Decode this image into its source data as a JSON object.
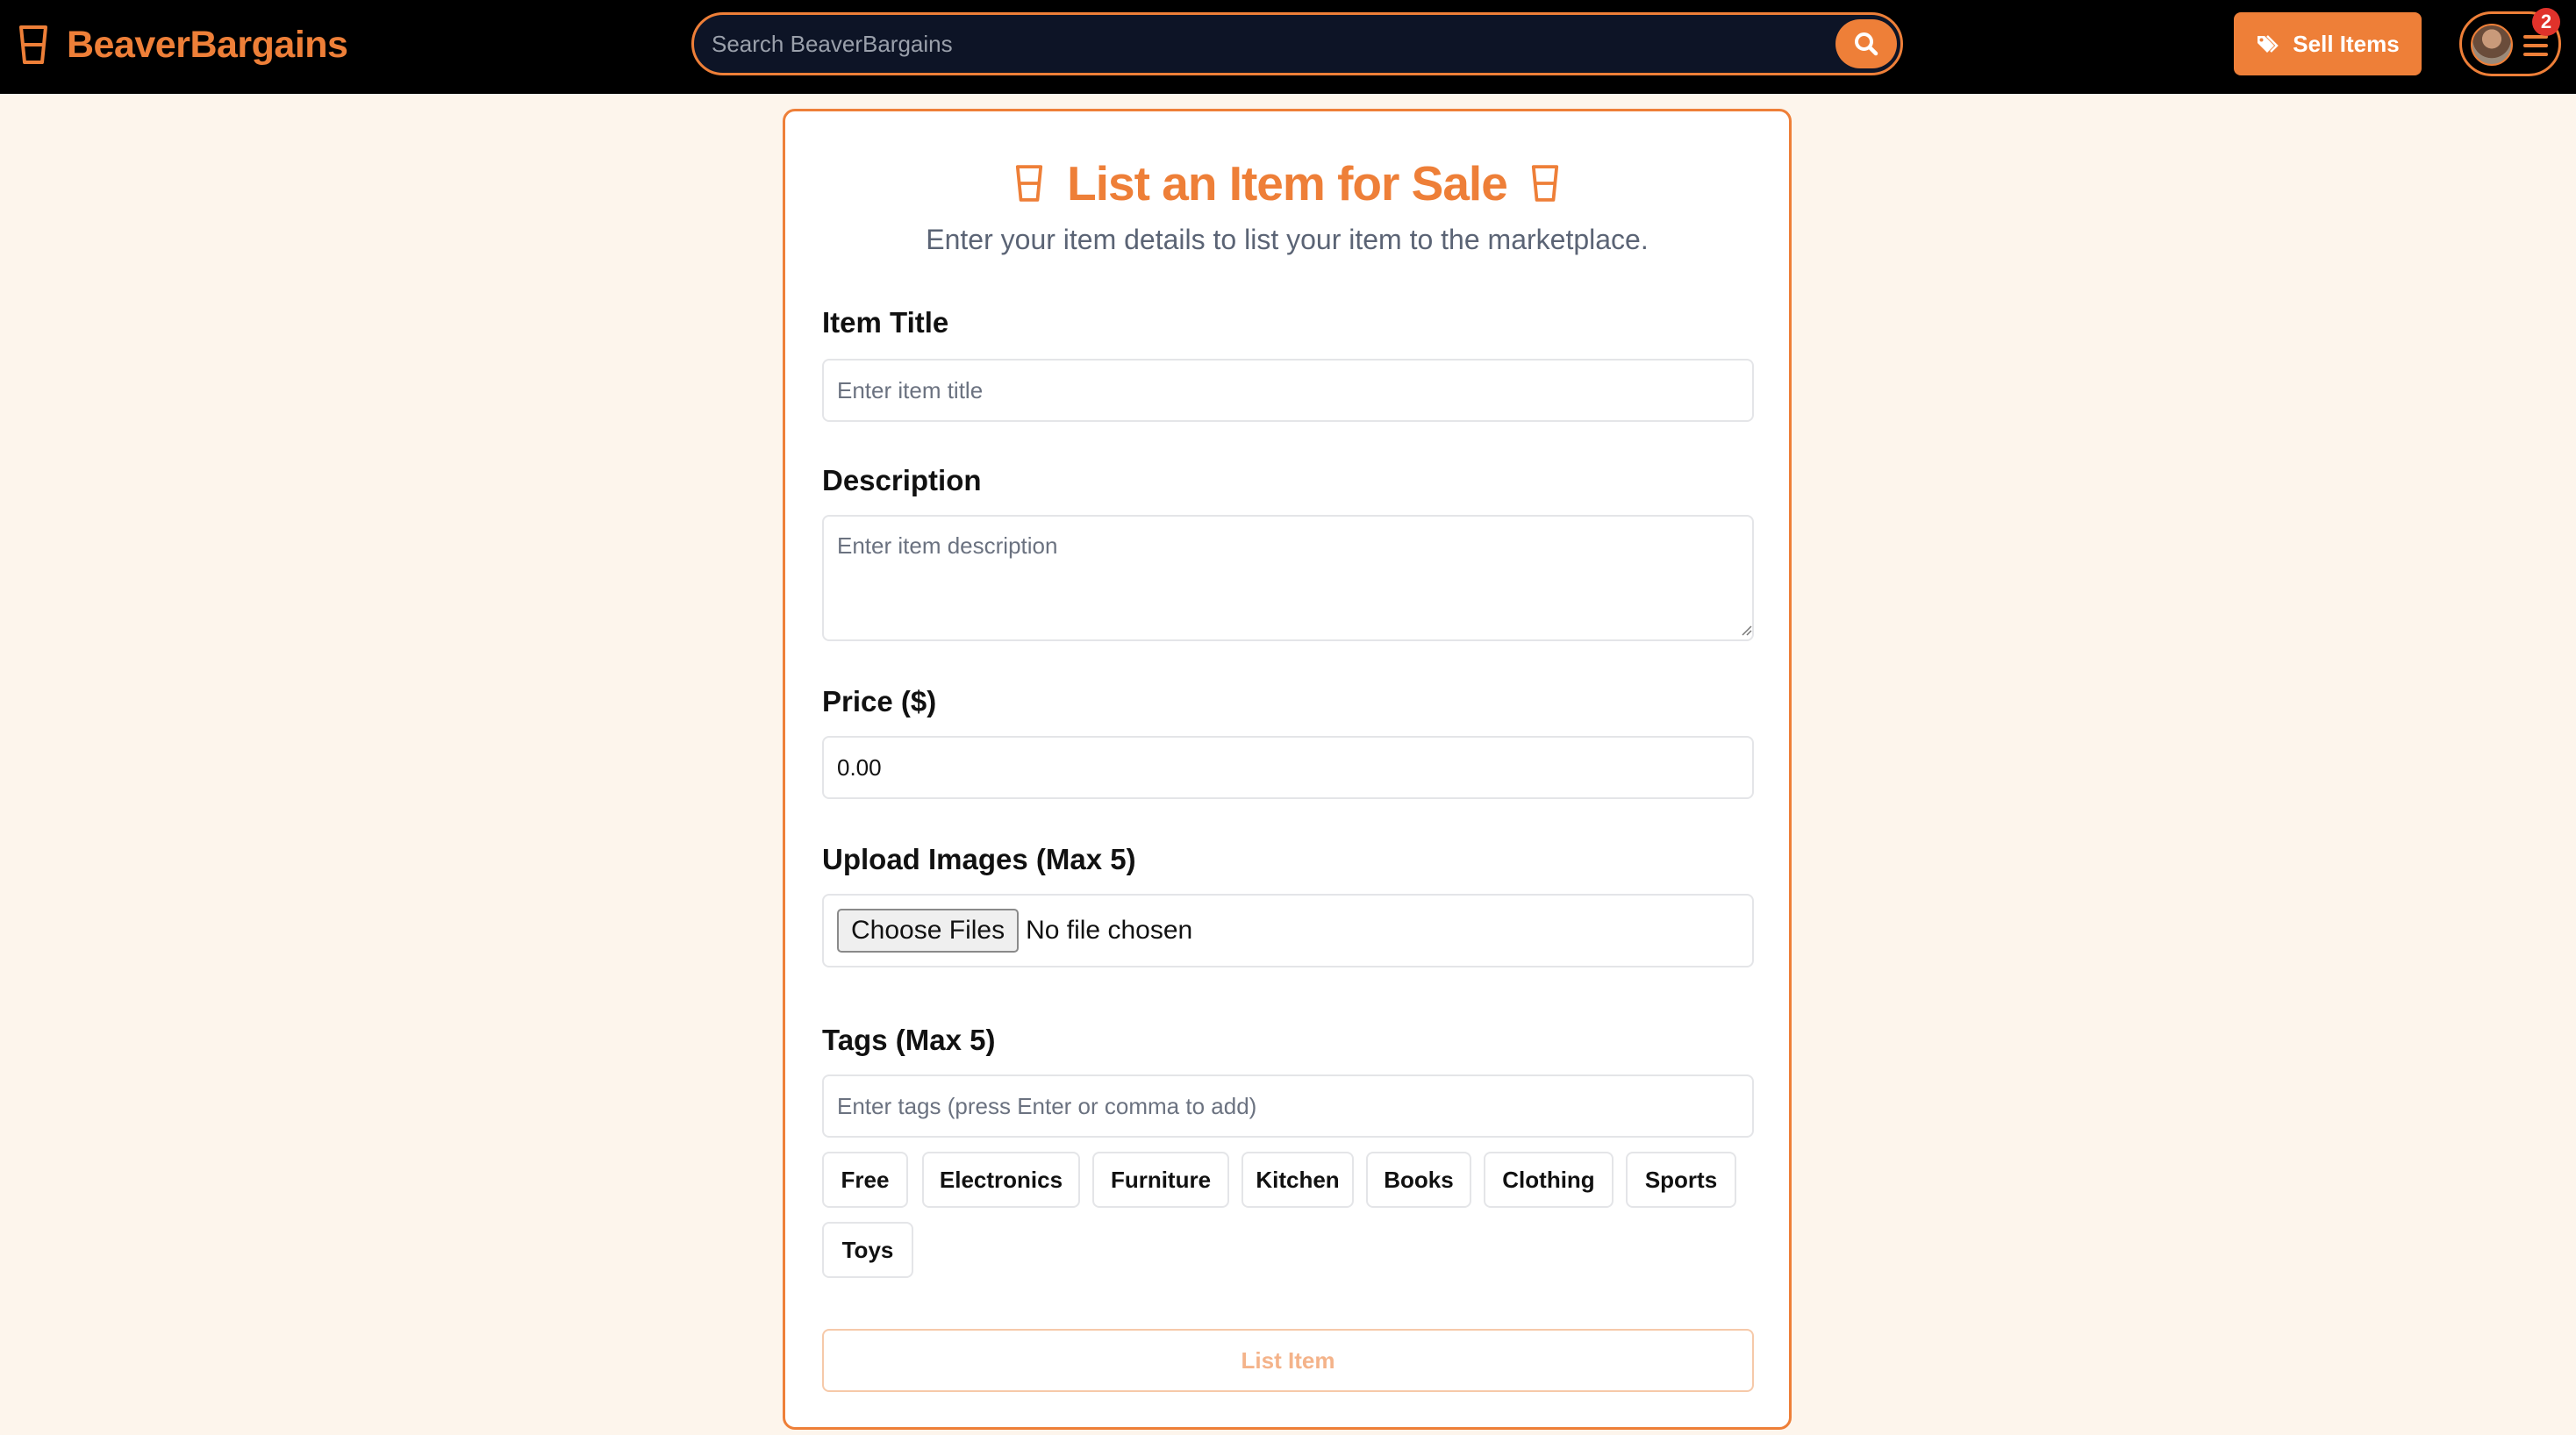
{
  "colors": {
    "accent": "#ee7f38",
    "navbar": "#000000",
    "page_bg": "#fdf5ec",
    "badge": "#e0322b"
  },
  "header": {
    "brand": "BeaverBargains",
    "brand_icon": "cup-icon",
    "search_placeholder": "Search BeaverBargains",
    "sell_label": "Sell Items",
    "notification_count": "2"
  },
  "form": {
    "title": "List an Item for Sale",
    "subtitle": "Enter your item details to list your item to the marketplace.",
    "item_title": {
      "label": "Item Title",
      "placeholder": "Enter item title"
    },
    "description": {
      "label": "Description",
      "placeholder": "Enter item description"
    },
    "price": {
      "label": "Price ($)",
      "value": "0.00"
    },
    "images": {
      "label": "Upload Images (Max 5)",
      "button": "Choose Files",
      "status": "No file chosen"
    },
    "tags": {
      "label": "Tags (Max 5)",
      "placeholder": "Enter tags (press Enter or comma to add)",
      "options": [
        "Free",
        "Electronics",
        "Furniture",
        "Kitchen",
        "Books",
        "Clothing",
        "Sports",
        "Toys"
      ]
    },
    "submit_label": "List Item"
  }
}
